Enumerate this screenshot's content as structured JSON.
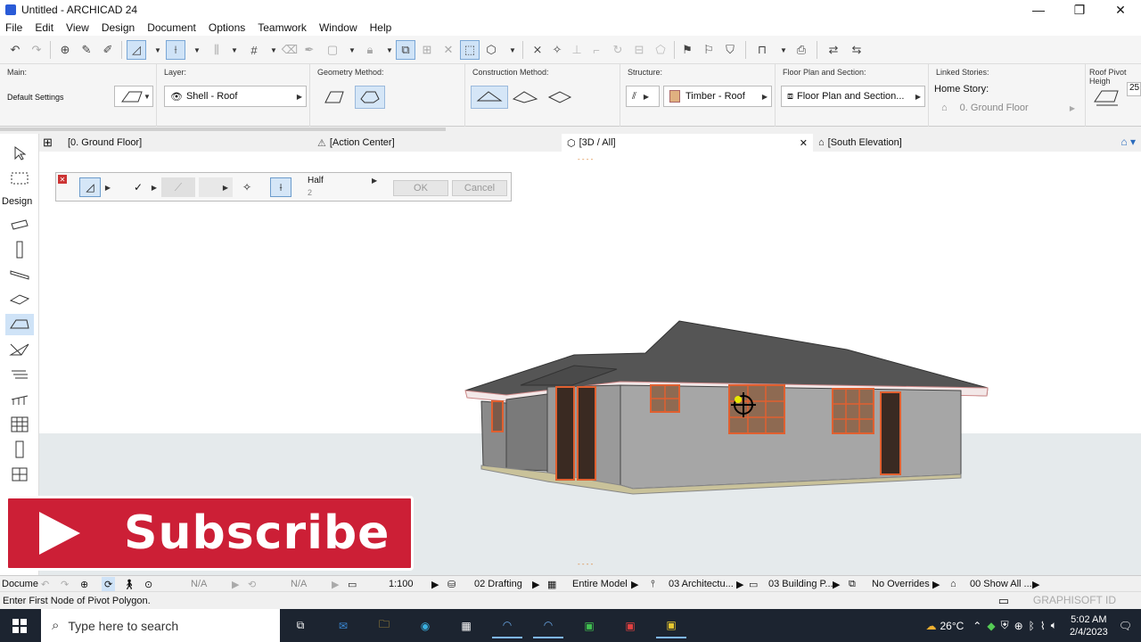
{
  "window": {
    "title": "Untitled - ARCHICAD 24",
    "minimize": "—",
    "maximize": "❐",
    "close": "✕"
  },
  "menu": [
    "File",
    "Edit",
    "View",
    "Design",
    "Document",
    "Options",
    "Teamwork",
    "Window",
    "Help"
  ],
  "infobox": {
    "main_label": "Main:",
    "main_value": "Default Settings",
    "layer_label": "Layer:",
    "layer_value": "Shell - Roof",
    "geometry_label": "Geometry Method:",
    "construction_label": "Construction Method:",
    "structure_label": "Structure:",
    "structure_value": "Timber - Roof",
    "floorplan_label": "Floor Plan and Section:",
    "floorplan_value": "Floor Plan and Section...",
    "linked_label": "Linked Stories:",
    "home_story_label": "Home Story:",
    "home_story_value": "0. Ground Floor",
    "pivot_label": "Roof Pivot Heigh",
    "pivot_value": "25"
  },
  "tabs": [
    {
      "label": "[0. Ground Floor]"
    },
    {
      "label": "[Action Center]"
    },
    {
      "label": "[3D / All]"
    },
    {
      "label": "[South Elevation]"
    }
  ],
  "toolbox": {
    "design_label": "Design"
  },
  "pet_palette": {
    "option_label": "Half",
    "option_value": "2",
    "ok": "OK",
    "cancel": "Cancel"
  },
  "subscribe": {
    "text": "Subscribe"
  },
  "quick_options": {
    "documents_label": "Docume",
    "na1": "N/A",
    "na2": "N/A",
    "scale": "1:100",
    "pen_set": "02 Drafting",
    "model_filter": "Entire Model",
    "structure_display": "03 Architectu...",
    "layer_combo": "03 Building P...",
    "overrides": "No Overrides",
    "renovation": "00 Show All ..."
  },
  "status": {
    "message": "Enter First Node of Pivot Polygon.",
    "brand": "GRAPHISOFT ID"
  },
  "taskbar": {
    "search_placeholder": "Type here to search",
    "temperature": "26°C",
    "time": "5:02 AM",
    "date": "2/4/2023"
  }
}
